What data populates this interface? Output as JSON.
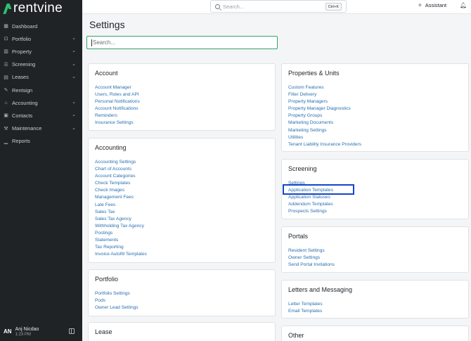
{
  "brand": {
    "name": "rentvine"
  },
  "sidebar": {
    "items": [
      {
        "label": "Dashboard",
        "icon": "grid-icon",
        "chevron": false
      },
      {
        "label": "Portfolio",
        "icon": "briefcase-icon",
        "chevron": true
      },
      {
        "label": "Property",
        "icon": "building-icon",
        "chevron": true
      },
      {
        "label": "Screening",
        "icon": "filter-icon",
        "chevron": true
      },
      {
        "label": "Leases",
        "icon": "document-icon",
        "chevron": true
      },
      {
        "label": "Rentsign",
        "icon": "signature-icon",
        "chevron": false
      },
      {
        "label": "Accounting",
        "icon": "bank-icon",
        "chevron": true
      },
      {
        "label": "Contacts",
        "icon": "contact-card-icon",
        "chevron": true
      },
      {
        "label": "Maintenance",
        "icon": "wrench-icon",
        "chevron": true
      },
      {
        "label": "Reports",
        "icon": "chart-icon",
        "chevron": false
      }
    ],
    "user": {
      "initials": "AN",
      "name": "Anj Nicdao",
      "time": "1:23 PM"
    }
  },
  "topbar": {
    "search_placeholder": "Search...",
    "shortcut": "Ctrl+K",
    "assistant_label": "Assistant"
  },
  "page": {
    "title": "Settings",
    "search_placeholder": "Search..."
  },
  "cards": {
    "account": {
      "title": "Account",
      "links": [
        "Account Manager",
        "Users, Roles and API",
        "Personal Notifications",
        "Account Notifications",
        "Reminders",
        "Insurance Settings"
      ]
    },
    "accounting": {
      "title": "Accounting",
      "links": [
        "Accounting Settings",
        "Chart of Accounts",
        "Account Categories",
        "Check Templates",
        "Check Images",
        "Management Fees",
        "Late Fees",
        "Sales Tax",
        "Sales Tax Agency",
        "Withholding Tax Agency",
        "Postings",
        "Statements",
        "Tax Reporting",
        "Invoice Autofill Templates"
      ]
    },
    "portfolio": {
      "title": "Portfolio",
      "links": [
        "Portfolio Settings",
        "Pods",
        "Owner Lead Settings"
      ]
    },
    "lease": {
      "title": "Lease",
      "links": []
    },
    "properties": {
      "title": "Properties & Units",
      "links": [
        "Custom Features",
        "Filter Delivery",
        "Property Managers",
        "Property Manager Diagnostics",
        "Property Groups",
        "Marketing Documents",
        "Marketing Settings",
        "Utilities",
        "Tenant Liability Insurance Providers"
      ]
    },
    "screening": {
      "title": "Screening",
      "links": [
        "Settings",
        "Application Templates",
        "Application Statuses",
        "Addendum Templates",
        "Prospects Settings"
      ]
    },
    "portals": {
      "title": "Portals",
      "links": [
        "Resident Settings",
        "Owner Settings",
        "Send Portal Invitations"
      ]
    },
    "letters": {
      "title": "Letters and Messaging",
      "links": [
        "Letter Templates",
        "Email Templates"
      ]
    },
    "other": {
      "title": "Other",
      "links": []
    }
  }
}
